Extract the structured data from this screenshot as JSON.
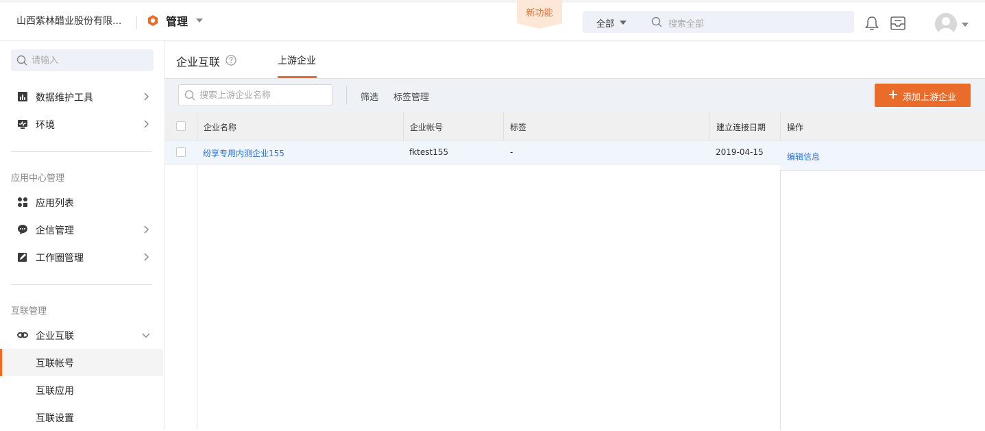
{
  "header": {
    "company": "山西紫林醋业股份有限...",
    "module": "管理",
    "new_feature": "新功能",
    "search_scope": "全部",
    "search_placeholder": "搜索全部",
    "accent_color": "#ea6c2a"
  },
  "sidebar": {
    "search_placeholder": "请输入",
    "items": [
      {
        "label": "数据维护工具",
        "icon": "bar-chart-icon"
      },
      {
        "label": "环境",
        "icon": "monitor-icon"
      }
    ],
    "section_app": "应用中心管理",
    "app_items": [
      {
        "label": "应用列表",
        "icon": "grid-icon"
      },
      {
        "label": "企信管理",
        "icon": "chat-icon"
      },
      {
        "label": "工作圈管理",
        "icon": "edit-icon"
      }
    ],
    "section_link": "互联管理",
    "link_group": {
      "label": "企业互联",
      "icon": "link-icon"
    },
    "link_sub": [
      "互联帐号",
      "互联应用",
      "互联设置"
    ]
  },
  "main": {
    "title": "企业互联",
    "tab": "上游企业",
    "toolbar": {
      "search_placeholder": "搜索上游企业名称",
      "filter": "筛选",
      "tag_manage": "标签管理",
      "add_button": "添加上游企业"
    },
    "table": {
      "columns": [
        "企业名称",
        "企业帐号",
        "标签",
        "建立连接日期",
        "操作"
      ],
      "rows": [
        {
          "name": "纷享专用内测企业155",
          "account": "fktest155",
          "tag": "-",
          "date": "2019-04-15",
          "action": "编辑信息"
        }
      ]
    }
  }
}
